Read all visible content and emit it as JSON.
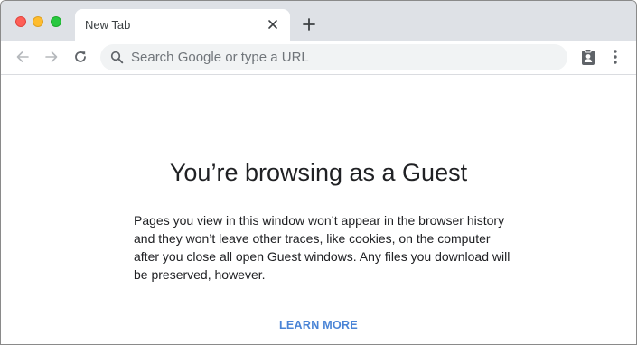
{
  "tab": {
    "title": "New Tab"
  },
  "omnibox": {
    "placeholder": "Search Google or type a URL",
    "value": ""
  },
  "content": {
    "headline": "You’re browsing as a Guest",
    "description": "Pages you view in this window won’t appear in the browser history and they won’t leave other traces, like cookies, on the computer after you close all open Guest windows. Any files you download will be preserved, however.",
    "learn_more_label": "LEARN MORE"
  },
  "icons": {
    "window_close": "close-window-dot",
    "window_minimize": "minimize-window-dot",
    "window_maximize": "maximize-window-dot",
    "tab_close": "close-icon",
    "new_tab": "plus-icon",
    "back": "arrow-left-icon",
    "forward": "arrow-right-icon",
    "reload": "reload-icon",
    "search": "search-icon",
    "guest_profile": "guest-profile-icon",
    "menu": "more-vert-icon"
  },
  "colors": {
    "tabstrip_bg": "#dee1e6",
    "omnibox_bg": "#f1f3f4",
    "link": "#4a84d6",
    "text": "#202124",
    "close_dot": "#fe5f57",
    "minimize_dot": "#febc2e",
    "maximize_dot": "#28c840"
  }
}
